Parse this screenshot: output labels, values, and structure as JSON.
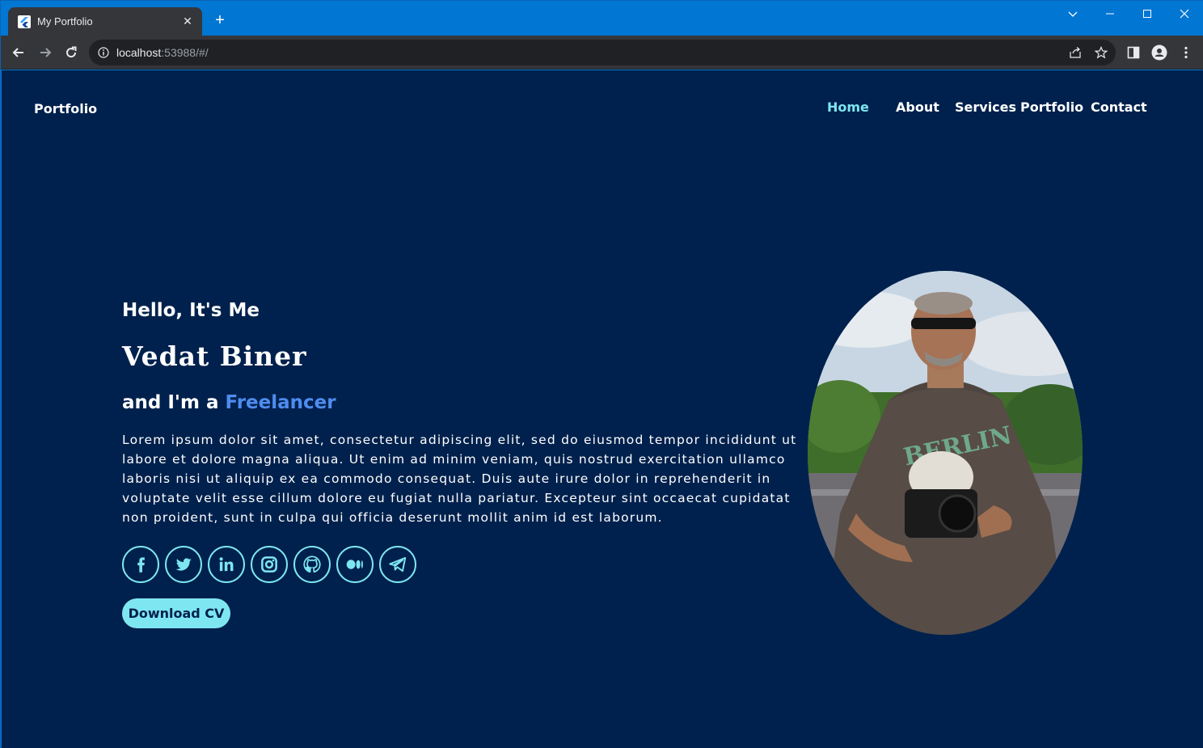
{
  "browser": {
    "tab_title": "My Portfolio",
    "url_host": "localhost",
    "url_rest": ":53988/#/"
  },
  "header": {
    "brand": "Portfolio",
    "nav": [
      {
        "label": "Home",
        "active": true
      },
      {
        "label": "About"
      },
      {
        "label": "Services"
      },
      {
        "label": "Portfolio"
      },
      {
        "label": "Contact"
      }
    ]
  },
  "hero": {
    "greeting": "Hello, It's Me",
    "name": "Vedat Biner",
    "role_prefix": "and I'm a ",
    "role_highlight": "Freelancer",
    "bio": "Lorem ipsum dolor sit amet, consectetur adipiscing elit, sed do eiusmod tempor incididunt ut labore et dolore magna aliqua. Ut enim ad minim veniam, quis nostrud exercitation ullamco laboris nisi ut aliquip ex ea commodo consequat. Duis aute irure dolor in reprehenderit in voluptate velit esse cillum dolore eu fugiat nulla pariatur. Excepteur sint occaecat cupidatat non proident, sunt in culpa qui officia deserunt mollit anim id est laborum.",
    "socials": [
      "facebook-icon",
      "twitter-icon",
      "linkedin-icon",
      "instagram-icon",
      "github-icon",
      "medium-icon",
      "telegram-icon"
    ],
    "cv_button": "Download CV"
  },
  "colors": {
    "background": "#00214d",
    "accent": "#7ee6f1",
    "highlight": "#4f8cf0"
  }
}
